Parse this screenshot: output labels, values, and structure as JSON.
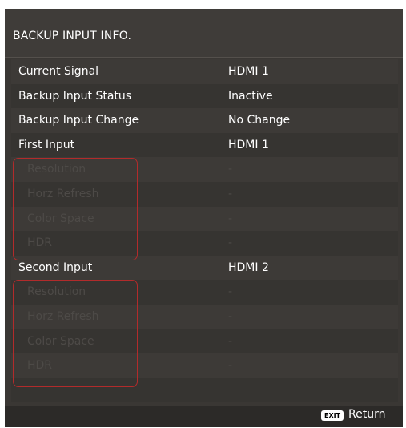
{
  "menu": {
    "title": "BACKUP INPUT INFO.",
    "rows": [
      {
        "label": "Current Signal",
        "value": "HDMI 1"
      },
      {
        "label": "Backup Input Status",
        "value": "Inactive"
      },
      {
        "label": "Backup Input Change",
        "value": "No Change"
      },
      {
        "label": "First Input",
        "value": "HDMI 1"
      },
      {
        "label": "Resolution",
        "value": "-"
      },
      {
        "label": "Horz Refresh",
        "value": "-"
      },
      {
        "label": "Color Space",
        "value": "-"
      },
      {
        "label": "HDR",
        "value": "-"
      },
      {
        "label": "Second Input",
        "value": "HDMI 2"
      },
      {
        "label": "Resolution",
        "value": "-"
      },
      {
        "label": "Horz Refresh",
        "value": "-"
      },
      {
        "label": "Color Space",
        "value": "-"
      },
      {
        "label": "HDR",
        "value": "-"
      },
      {
        "label": "",
        "value": ""
      }
    ]
  },
  "footer": {
    "exit_key": "EXIT",
    "return_label": "Return"
  },
  "colors": {
    "panel_bg": "#3a3734",
    "highlight_border": "#b22b2b",
    "disabled_text": "#4d4a47"
  }
}
